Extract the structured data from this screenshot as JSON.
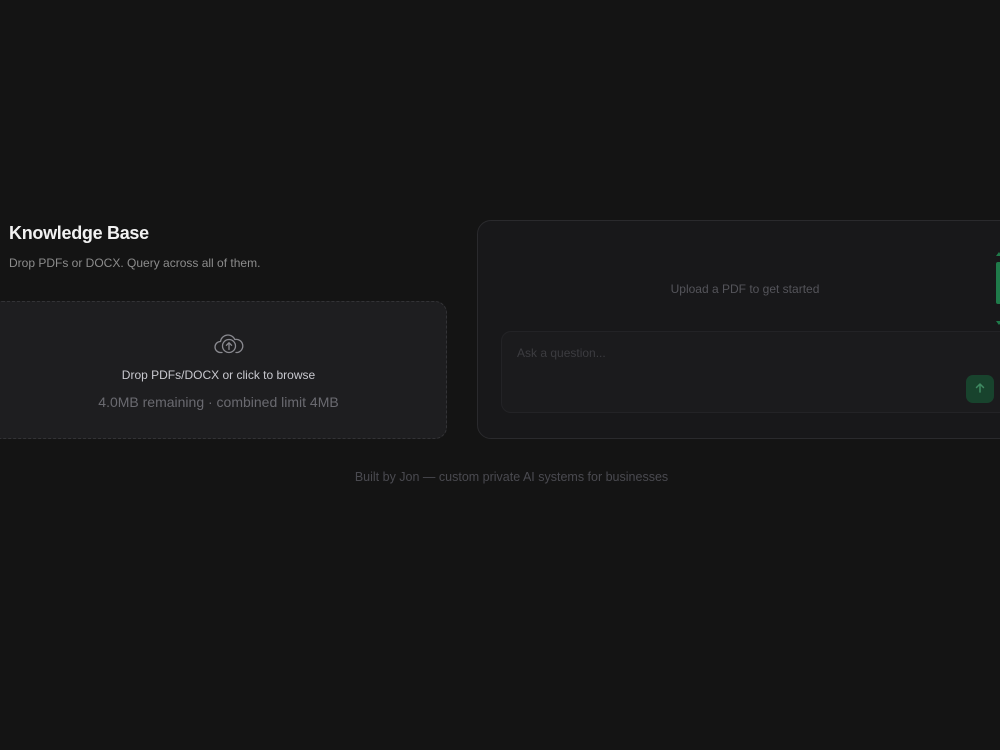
{
  "knowledge_base": {
    "title": "Knowledge Base",
    "subtitle": "Drop PDFs or DOCX. Query across all of them."
  },
  "dropzone": {
    "icon": "cloud-upload-icon",
    "label": "Drop PDFs/DOCX or click to browse",
    "limit_text": "4.0MB remaining · combined limit 4MB"
  },
  "chat": {
    "empty_state": "Upload a PDF to get started",
    "input_placeholder": "Ask a question...",
    "input_value": "",
    "send_icon": "arrow-up-icon"
  },
  "footer": {
    "text": "Built by Jon — custom private AI systems for businesses"
  },
  "colors": {
    "background": "#141414",
    "panel": "#1e1e20",
    "accent_green": "#1f7a4a",
    "send_button": "#18432d"
  }
}
